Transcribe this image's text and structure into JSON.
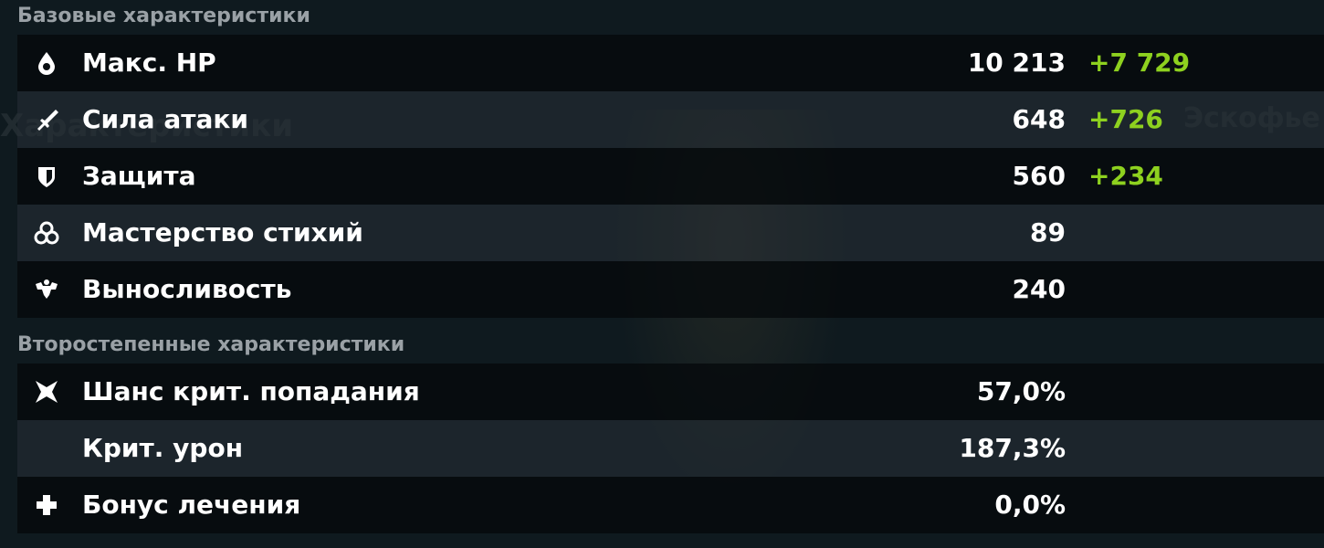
{
  "accent_bonus_color": "#8ed11f",
  "sections": {
    "base_title": "Базовые характеристики",
    "secondary_title": "Второстепенные характеристики"
  },
  "base_stats": [
    {
      "icon": "hp-drop-icon",
      "label": "Макс. HP",
      "value": "10 213",
      "bonus": "+7 729"
    },
    {
      "icon": "sword-icon",
      "label": "Сила атаки",
      "value": "648",
      "bonus": "+726"
    },
    {
      "icon": "shield-icon",
      "label": "Защита",
      "value": "560",
      "bonus": "+234"
    },
    {
      "icon": "elemental-mastery-icon",
      "label": "Мастерство стихий",
      "value": "89",
      "bonus": ""
    },
    {
      "icon": "stamina-icon",
      "label": "Выносливость",
      "value": "240",
      "bonus": ""
    }
  ],
  "secondary_stats": [
    {
      "icon": "crit-rate-icon",
      "label": "Шанс крит. попадания",
      "value": "57,0%"
    },
    {
      "icon": "",
      "label": "Крит. урон",
      "value": "187,3%"
    },
    {
      "icon": "healing-cross-icon",
      "label": "Бонус лечения",
      "value": "0,0%"
    }
  ]
}
